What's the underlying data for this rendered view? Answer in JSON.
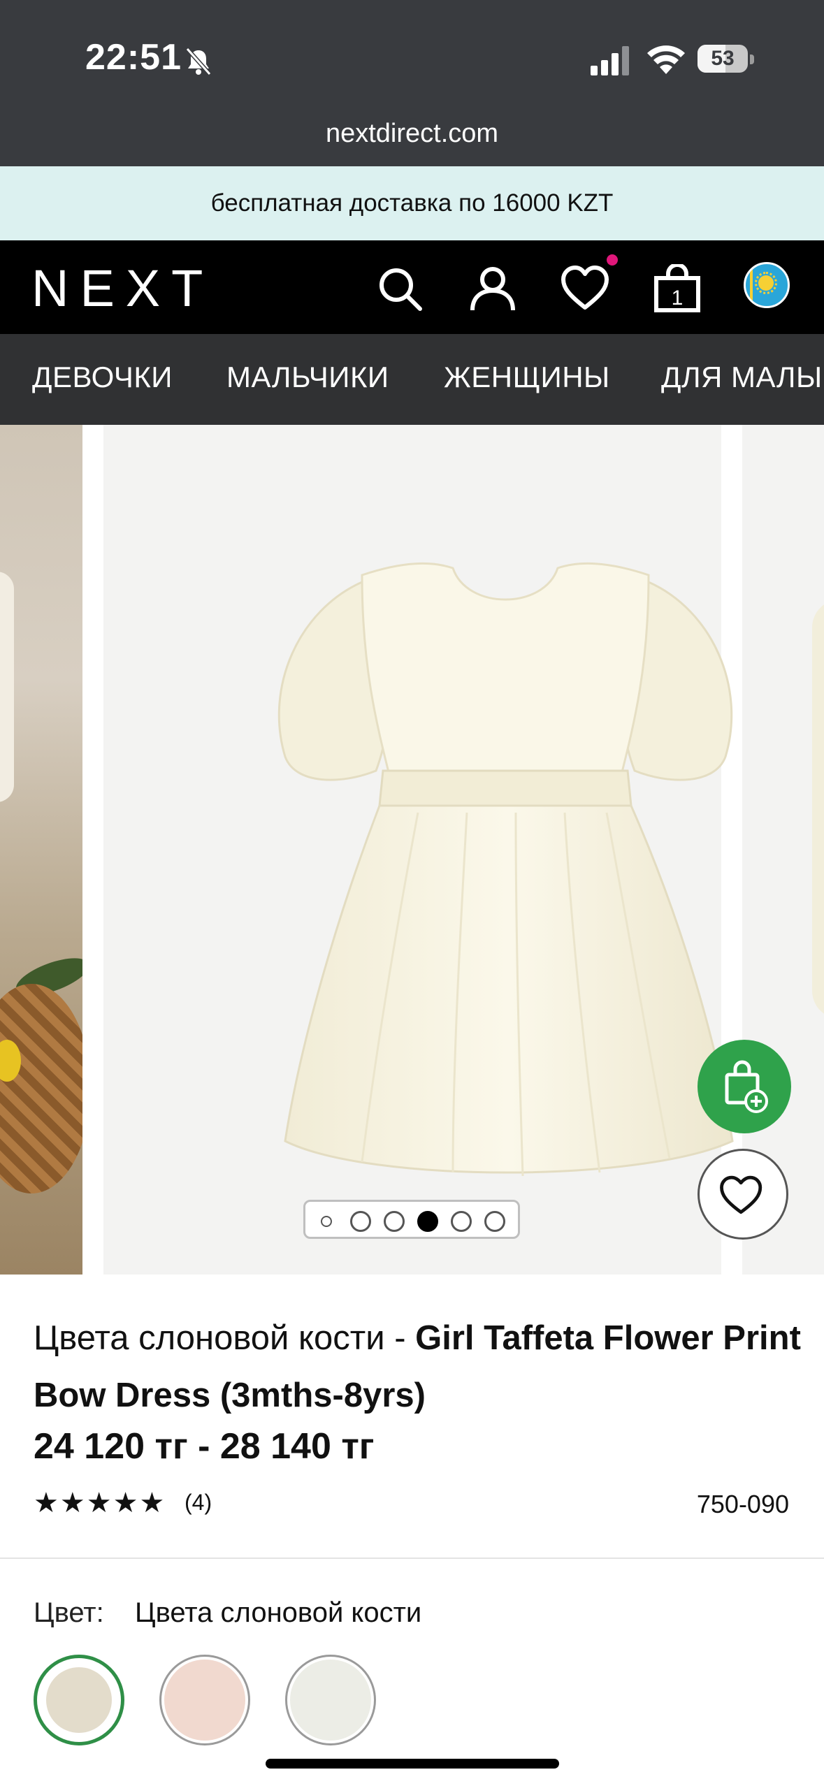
{
  "status_bar": {
    "time": "22:51",
    "battery": "53"
  },
  "browser": {
    "url": "nextdirect.com"
  },
  "promo": {
    "text": "бесплатная доставка по 16000 KZT"
  },
  "header": {
    "logo": "NEXT",
    "bag_count": "1",
    "accent_color": "#e0177a"
  },
  "nav": {
    "items": [
      "ДЕВОЧКИ",
      "МАЛЬЧИКИ",
      "ЖЕНЩИНЫ",
      "ДЛЯ МАЛЫ"
    ]
  },
  "gallery": {
    "image_count": 6,
    "active_index": 3
  },
  "product": {
    "title_color": "Цвета слоновой кости - ",
    "title_name": "Girl Taffeta Flower Print Bow Dress (3mths-8yrs)",
    "price": "24 120 тг - 28 140 тг",
    "rating_stars": "★★★★★",
    "rating_value": 5,
    "review_count": "(4)",
    "sku": "750-090"
  },
  "color_selector": {
    "label": "Цвет:",
    "value": "Цвета слоновой кости",
    "swatches": [
      {
        "name": "ivory",
        "color": "#e3dccb",
        "selected": true
      },
      {
        "name": "pink",
        "color": "#f1d9cf",
        "selected": false
      },
      {
        "name": "white",
        "color": "#ecede6",
        "selected": false
      }
    ]
  }
}
